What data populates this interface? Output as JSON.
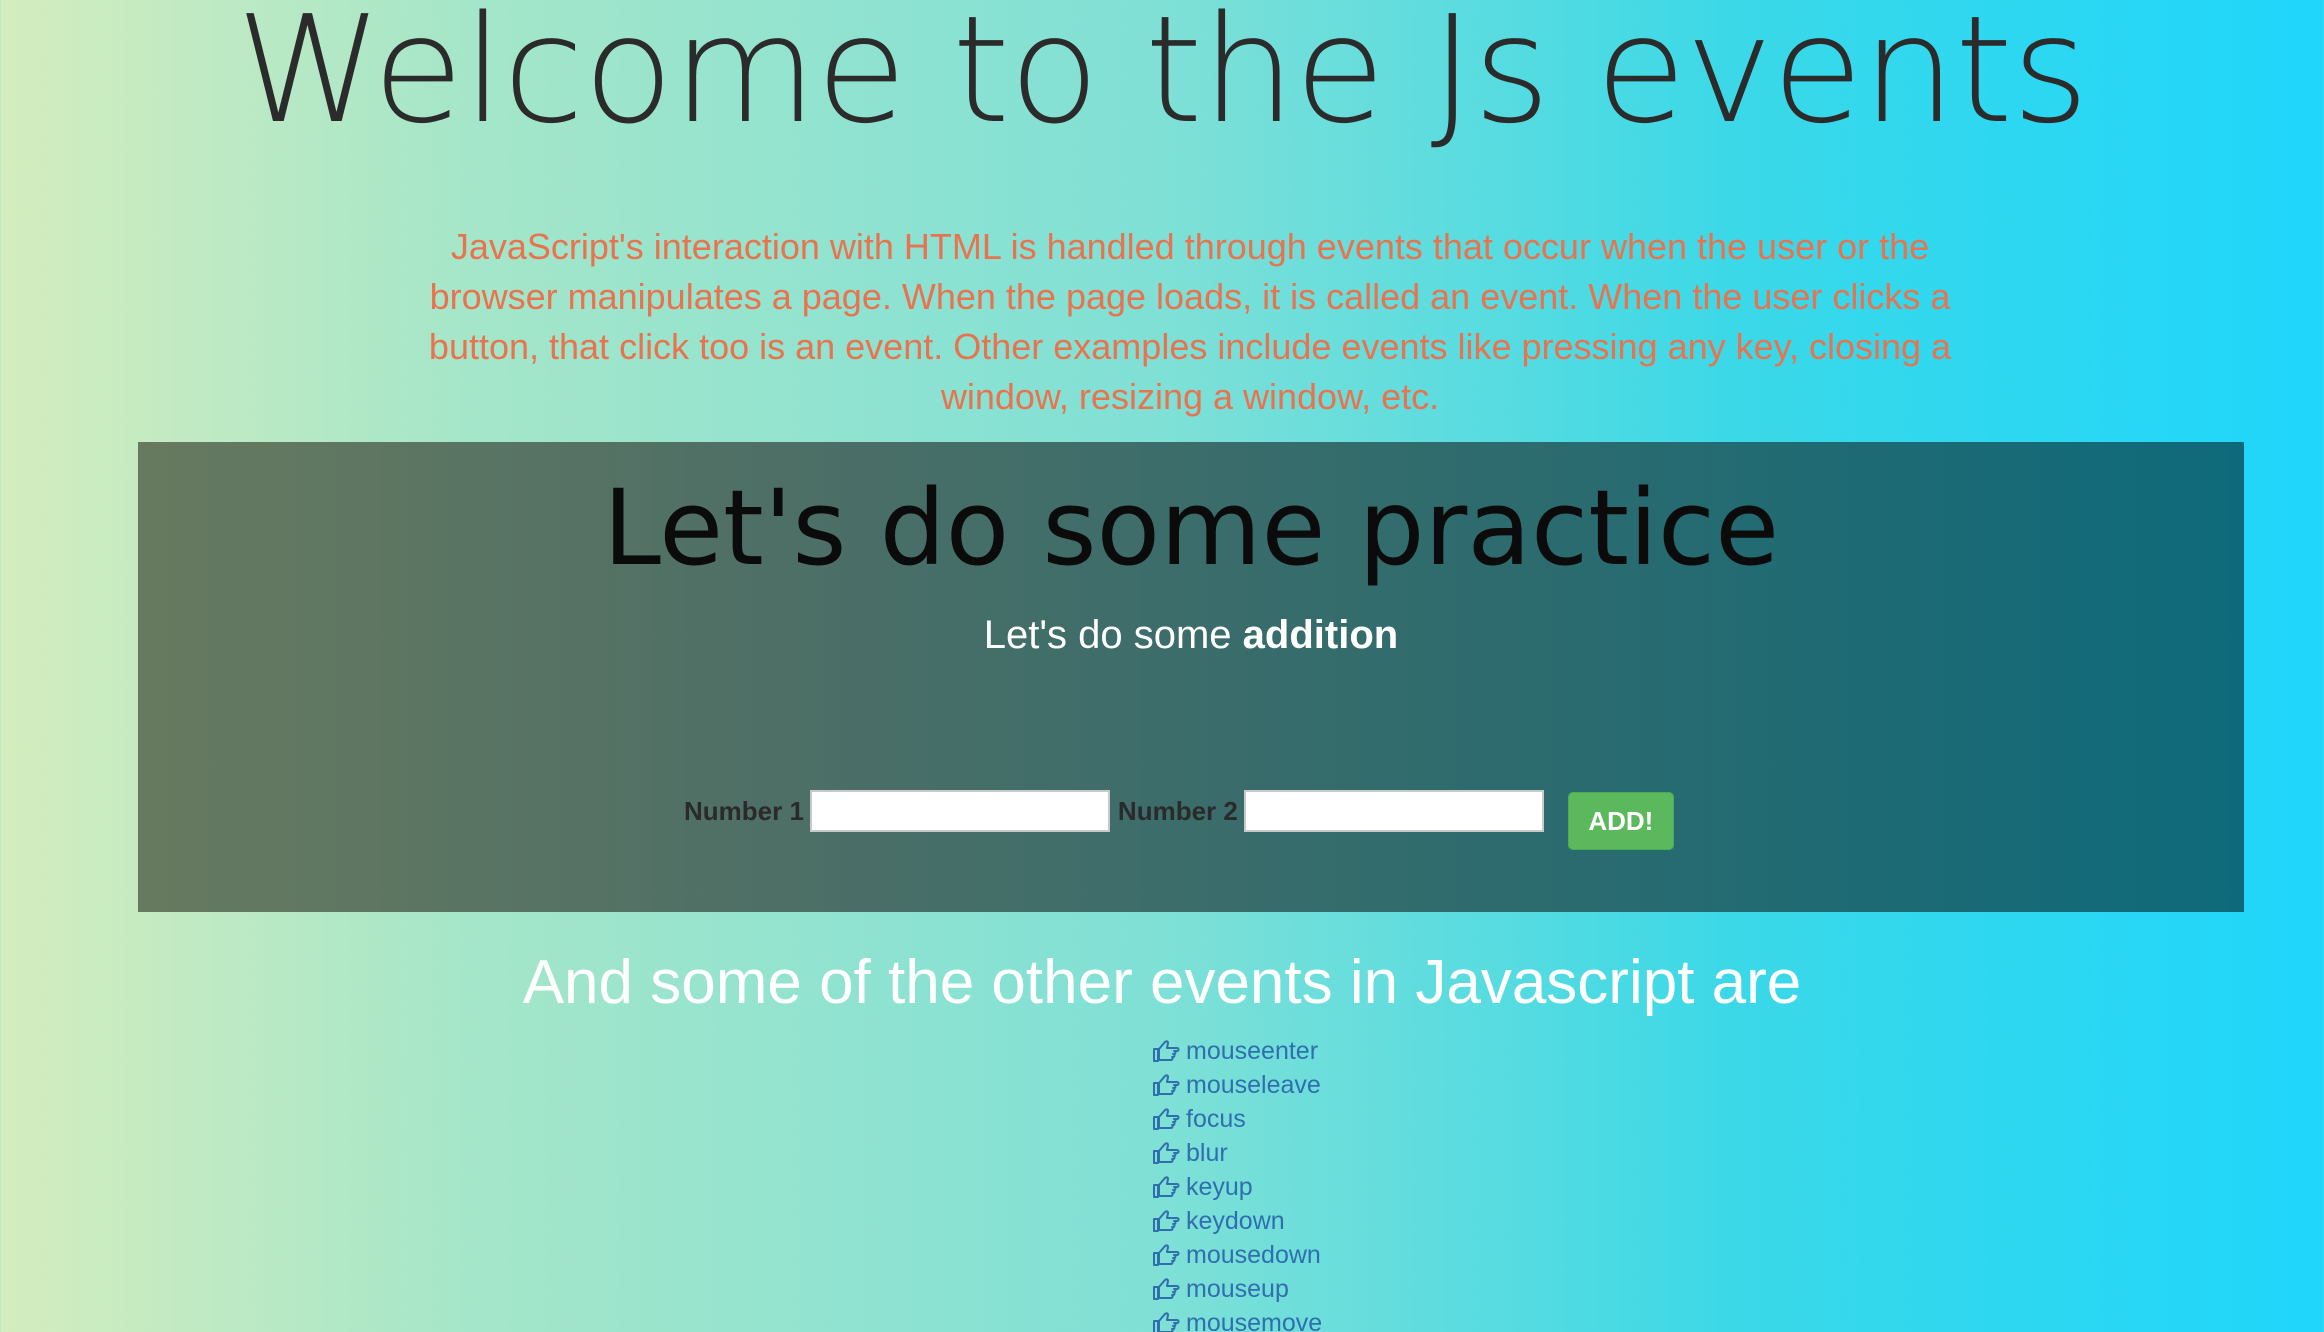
{
  "header": {
    "title": "Welcome to the Js events",
    "intro": "JavaScript's interaction with HTML is handled through events that occur when the user or the browser manipulates a page. When the page loads, it is called an event. When the user clicks a button, that click too is an event. Other examples include events like pressing any key, closing a window, resizing a window, etc."
  },
  "practice": {
    "title": "Let's do some practice",
    "subtitle_prefix": "Let's do some ",
    "subtitle_bold": "addition",
    "number1_label": "Number 1",
    "number1_value": "",
    "number2_label": "Number 2",
    "number2_value": "",
    "add_button_label": "ADD!"
  },
  "events": {
    "heading": "And some of the other events in Javascript are",
    "icon": "hand-point-right-icon",
    "items": [
      "mouseenter",
      "mouseleave",
      "focus",
      "blur",
      "keyup",
      "keydown",
      "mousedown",
      "mouseup",
      "mousemove"
    ]
  },
  "colors": {
    "intro_text": "#e9734f",
    "button_green": "#5cb85c",
    "link_blue": "#2f6fae"
  }
}
